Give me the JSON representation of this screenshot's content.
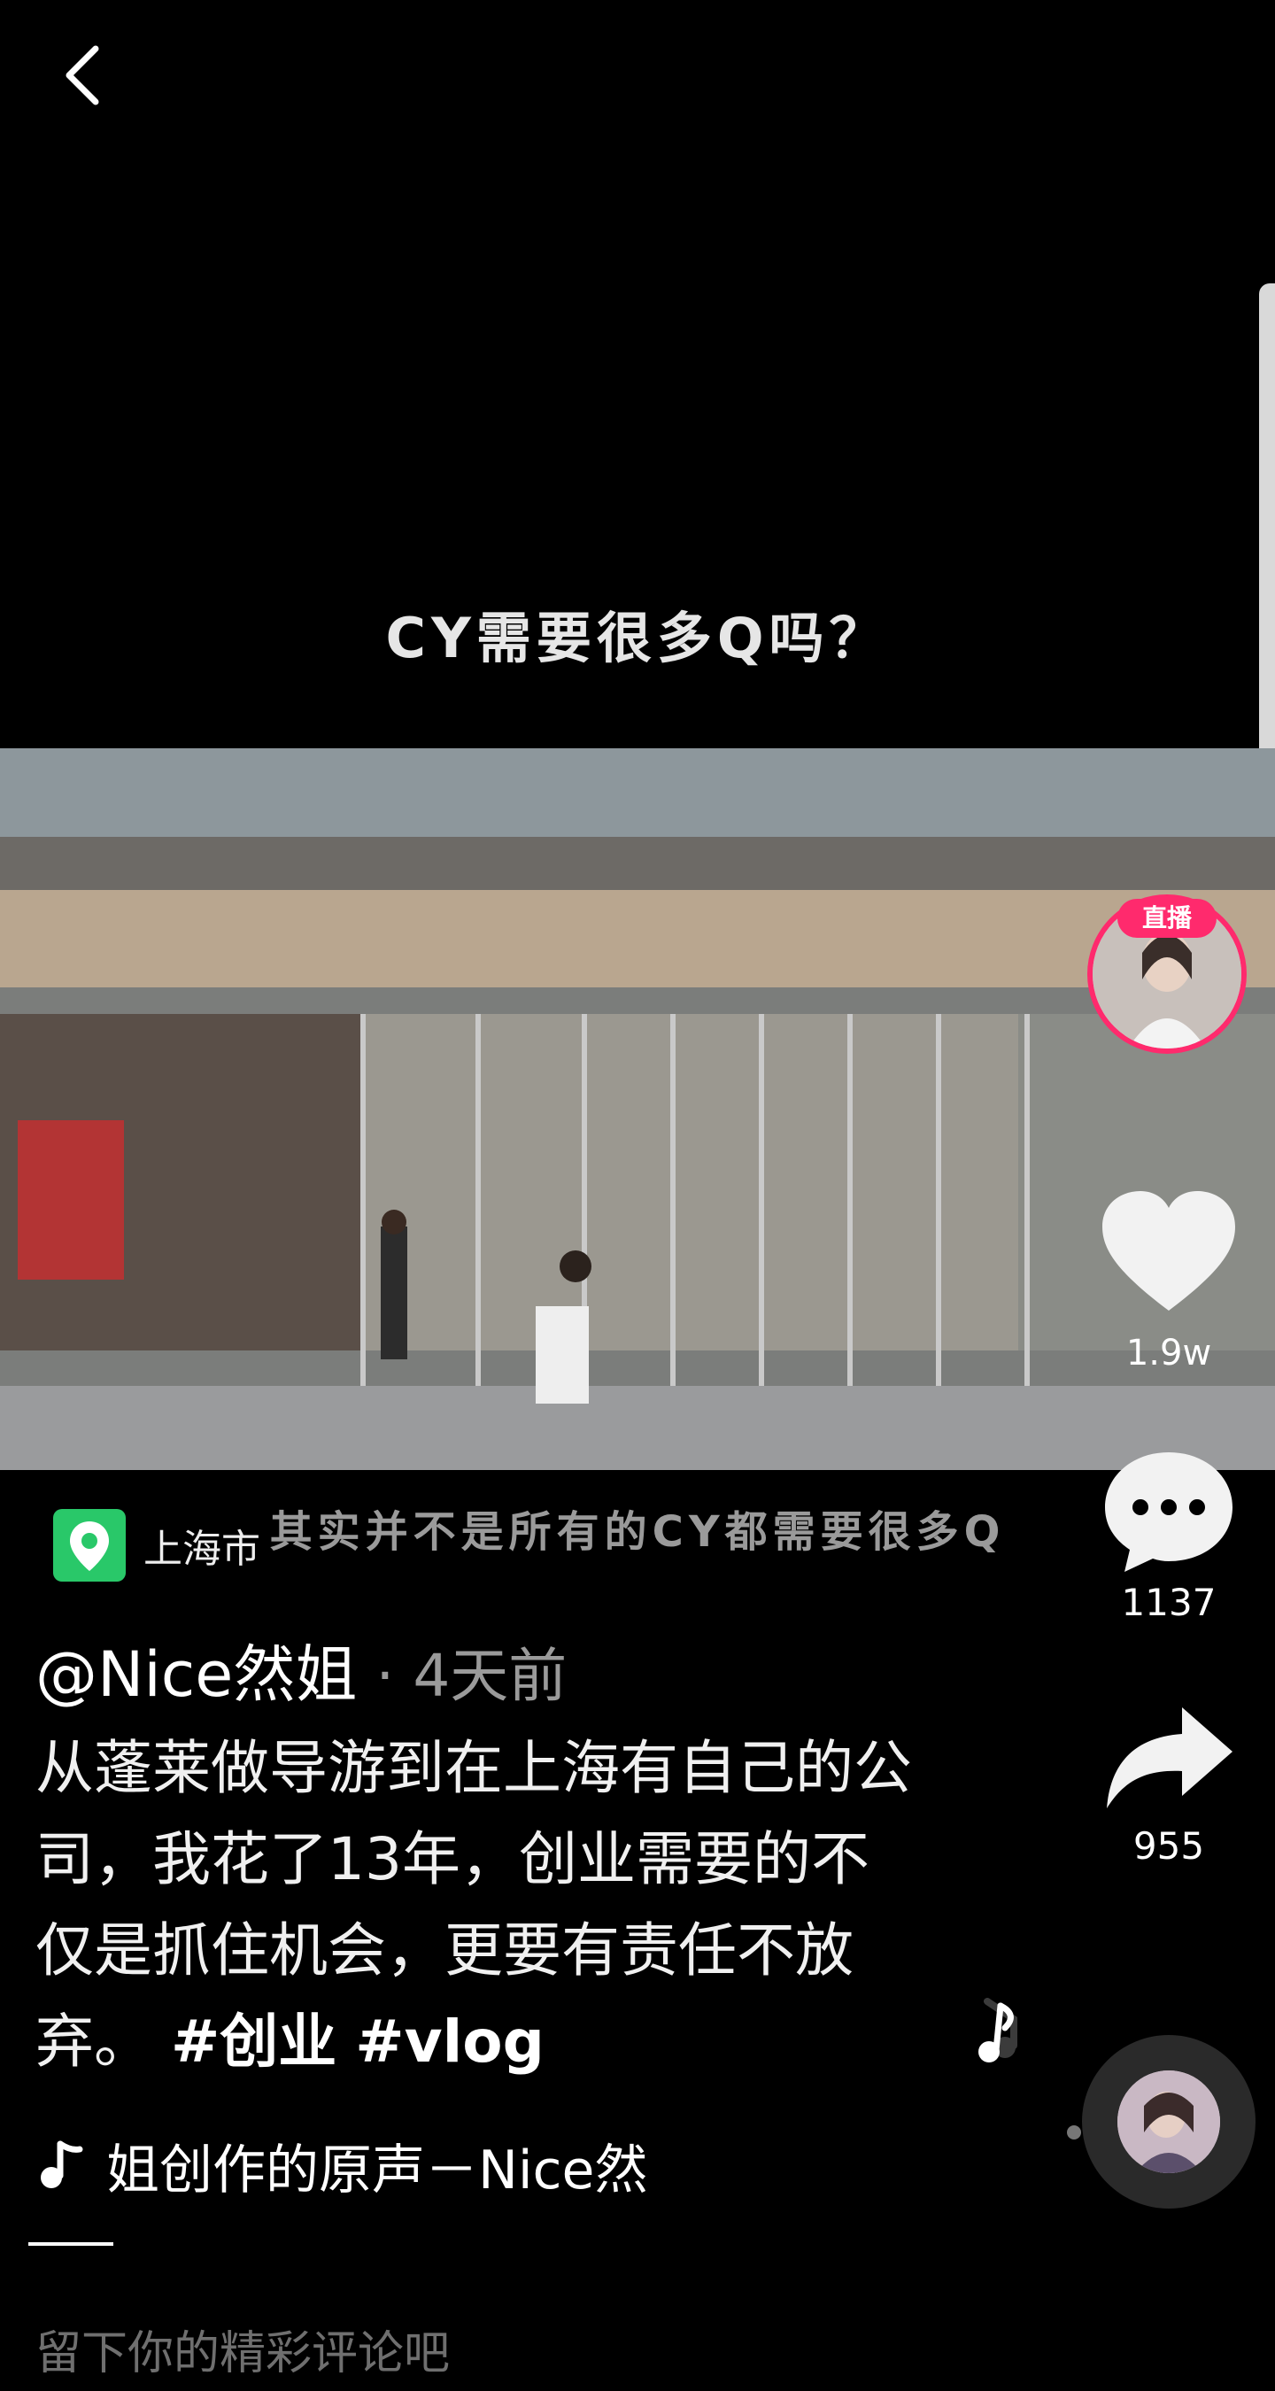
{
  "nav": {
    "back_icon": "chevron-left-icon"
  },
  "video": {
    "top_caption": "CY需要很多Q吗？",
    "bottom_caption": "其实并不是所有的CY都需要很多Q"
  },
  "live": {
    "badge": "直播"
  },
  "actions": {
    "like_count": "1.9w",
    "comment_count": "1137",
    "share_count": "955"
  },
  "location": {
    "label": "上海市",
    "icon": "map-pin-icon"
  },
  "post": {
    "author": "@Nice然姐",
    "time": " · 4天前",
    "description": "从蓬莱做导游到在上海有自己的公司，我花了13年，创业需要的不仅是抓住机会，更要有责任不放弃。",
    "tags": [
      "#创业",
      "#vlog"
    ]
  },
  "music": {
    "icon": "music-note-icon",
    "title": "姐创作的原声－Nice然"
  },
  "comment": {
    "placeholder": "留下你的精彩评论吧"
  },
  "colors": {
    "live_ring": "#ff2a6d",
    "location_green": "#29c869"
  }
}
